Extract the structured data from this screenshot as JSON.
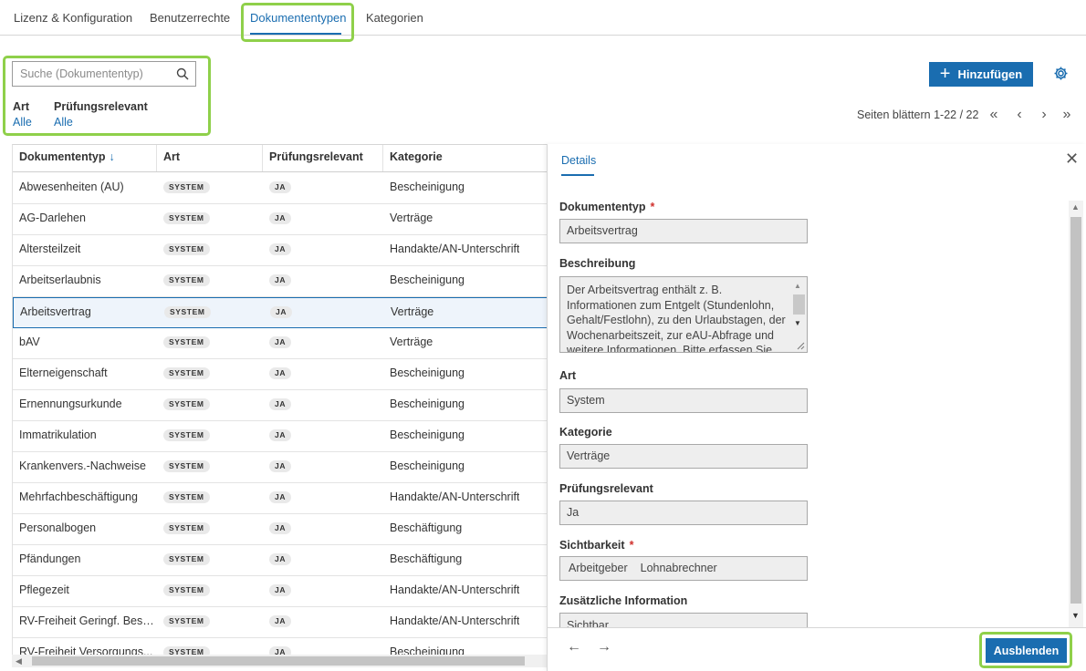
{
  "tabs": [
    {
      "label": "Lizenz & Konfiguration"
    },
    {
      "label": "Benutzerrechte"
    },
    {
      "label": "Dokumententypen"
    },
    {
      "label": "Kategorien"
    }
  ],
  "search": {
    "placeholder": "Suche (Dokumententyp)"
  },
  "filters": [
    {
      "label": "Art",
      "value": "Alle"
    },
    {
      "label": "Prüfungsrelevant",
      "value": "Alle"
    }
  ],
  "toolbar": {
    "add_label": "Hinzufügen"
  },
  "pager": {
    "text": "Seiten blättern 1-22 / 22"
  },
  "table": {
    "columns": [
      "Dokumententyp",
      "Art",
      "Prüfungsrelevant",
      "Kategorie"
    ],
    "sort_indicator": "↓",
    "rows": [
      {
        "name": "Abwesenheiten (AU)",
        "art": "SYSTEM",
        "pr": "JA",
        "kategorie": "Bescheinigung"
      },
      {
        "name": "AG-Darlehen",
        "art": "SYSTEM",
        "pr": "JA",
        "kategorie": "Verträge"
      },
      {
        "name": "Altersteilzeit",
        "art": "SYSTEM",
        "pr": "JA",
        "kategorie": "Handakte/AN-Unterschrift"
      },
      {
        "name": "Arbeitserlaubnis",
        "art": "SYSTEM",
        "pr": "JA",
        "kategorie": "Bescheinigung"
      },
      {
        "name": "Arbeitsvertrag",
        "art": "SYSTEM",
        "pr": "JA",
        "kategorie": "Verträge"
      },
      {
        "name": "bAV",
        "art": "SYSTEM",
        "pr": "JA",
        "kategorie": "Verträge"
      },
      {
        "name": "Elterneigenschaft",
        "art": "SYSTEM",
        "pr": "JA",
        "kategorie": "Bescheinigung"
      },
      {
        "name": "Ernennungsurkunde",
        "art": "SYSTEM",
        "pr": "JA",
        "kategorie": "Bescheinigung"
      },
      {
        "name": "Immatrikulation",
        "art": "SYSTEM",
        "pr": "JA",
        "kategorie": "Bescheinigung"
      },
      {
        "name": "Krankenvers.-Nachweise",
        "art": "SYSTEM",
        "pr": "JA",
        "kategorie": "Bescheinigung"
      },
      {
        "name": "Mehrfachbeschäftigung",
        "art": "SYSTEM",
        "pr": "JA",
        "kategorie": "Handakte/AN-Unterschrift"
      },
      {
        "name": "Personalbogen",
        "art": "SYSTEM",
        "pr": "JA",
        "kategorie": "Beschäftigung"
      },
      {
        "name": "Pfändungen",
        "art": "SYSTEM",
        "pr": "JA",
        "kategorie": "Beschäftigung"
      },
      {
        "name": "Pflegezeit",
        "art": "SYSTEM",
        "pr": "JA",
        "kategorie": "Handakte/AN-Unterschrift"
      },
      {
        "name": "RV-Freiheit Geringf. Besc...",
        "art": "SYSTEM",
        "pr": "JA",
        "kategorie": "Handakte/AN-Unterschrift"
      },
      {
        "name": "RV-Freiheit Versorgungs...",
        "art": "SYSTEM",
        "pr": "JA",
        "kategorie": "Bescheinigung"
      }
    ],
    "selected_row": "Arbeitsvertrag"
  },
  "details": {
    "tab_label": "Details",
    "required_mark": "*",
    "dokumententyp": {
      "label": "Dokumententyp",
      "value": "Arbeitsvertrag"
    },
    "beschreibung": {
      "label": "Beschreibung",
      "value": "Der Arbeitsvertrag enthält z. B. Informationen zum Entgelt (Stundenlohn, Gehalt/Festlohn), zu den Urlaubstagen, der Wochenarbeitszeit, zur eAU-Abfrage und weitere Informationen. Bitte erfassen Sie"
    },
    "art": {
      "label": "Art",
      "value": "System"
    },
    "kategorie": {
      "label": "Kategorie",
      "value": "Verträge"
    },
    "pruefungsrelevant": {
      "label": "Prüfungsrelevant",
      "value": "Ja"
    },
    "sichtbarkeit": {
      "label": "Sichtbarkeit",
      "values": [
        "Arbeitgeber",
        "Lohnabrechner"
      ]
    },
    "zusatz": {
      "label": "Zusätzliche Information",
      "value": "Sichtbar"
    },
    "hide_label": "Ausblenden"
  },
  "colors": {
    "accent": "#1a6db0",
    "highlight": "#8fd04a",
    "required": "#d0312d"
  }
}
